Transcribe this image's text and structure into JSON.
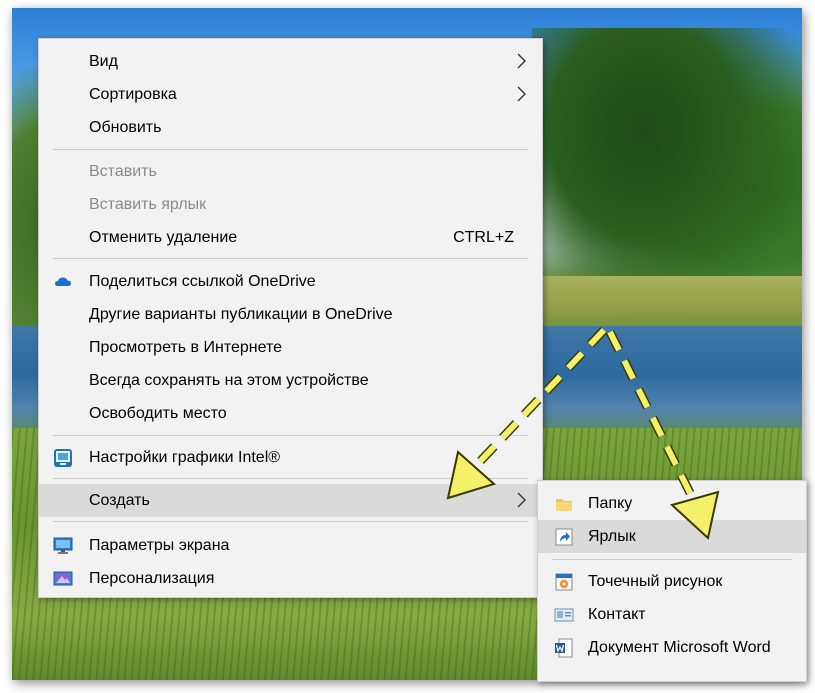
{
  "main_menu": {
    "items": [
      {
        "label": "Вид"
      },
      {
        "label": "Сортировка"
      },
      {
        "label": "Обновить"
      },
      {
        "label": "Вставить"
      },
      {
        "label": "Вставить ярлык"
      },
      {
        "label": "Отменить удаление",
        "shortcut": "CTRL+Z"
      },
      {
        "label": "Поделиться ссылкой OneDrive",
        "icon": "onedrive-cloud-icon"
      },
      {
        "label": "Другие варианты публикации в OneDrive"
      },
      {
        "label": "Просмотреть в Интернете"
      },
      {
        "label": "Всегда сохранять на этом устройстве"
      },
      {
        "label": "Освободить место"
      },
      {
        "label": "Настройки графики Intel®",
        "icon": "intel-graphics-icon"
      },
      {
        "label": "Создать"
      },
      {
        "label": "Параметры экрана",
        "icon": "monitor-icon"
      },
      {
        "label": "Персонализация",
        "icon": "personalization-icon"
      }
    ]
  },
  "sub_menu": {
    "items": [
      {
        "label": "Папку",
        "icon": "folder-icon"
      },
      {
        "label": "Ярлык",
        "icon": "shortcut-icon"
      },
      {
        "label": "Точечный рисунок",
        "icon": "bitmap-icon"
      },
      {
        "label": "Контакт",
        "icon": "contact-icon"
      },
      {
        "label": "Документ Microsoft Word",
        "icon": "word-document-icon"
      }
    ]
  },
  "colors": {
    "menu_bg": "#f2f2f2",
    "hover_bg": "#dadada",
    "disabled_text": "#8a8a8a",
    "annotation_arrow": "#f5f06a",
    "onedrive_blue": "#1e6fd0"
  }
}
